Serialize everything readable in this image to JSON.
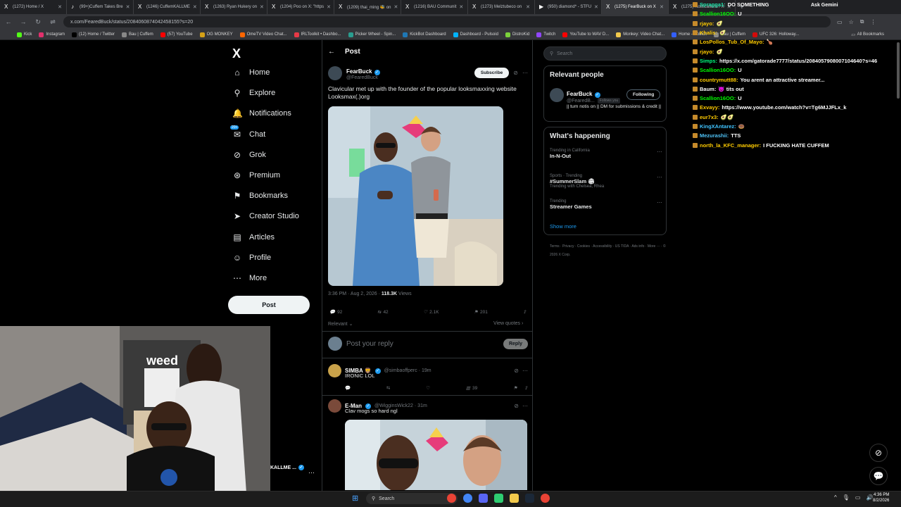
{
  "browser": {
    "tabs": [
      {
        "label": "(1272) Home / X",
        "icon": "X"
      },
      {
        "label": "(99+)Cuffem Takes Bre",
        "icon": "♪"
      },
      {
        "label": "(1246) CuffemKALLME",
        "icon": "X"
      },
      {
        "label": "(1263) Ryan Hukery on",
        "icon": "X"
      },
      {
        "label": "(1204) Poo on X: \"https",
        "icon": "X"
      },
      {
        "label": "(1209) thai_ming 🐝 on",
        "icon": "X"
      },
      {
        "label": "(1216) BAU Communit",
        "icon": "X"
      },
      {
        "label": "(1273) Melztubeco on",
        "icon": "X"
      },
      {
        "label": "(950) diamond* - STFU",
        "icon": "▶"
      },
      {
        "label": "(1275) FearBuck on X",
        "icon": "X",
        "active": true
      },
      {
        "label": "(1275) Notifications / X",
        "icon": "X"
      }
    ],
    "ask_gemini": "Ask Gemini",
    "url": "x.com/FearedBuck/status/2084060874042458155?s=20",
    "bookmarks": [
      "Kick",
      "Instagram",
      "(12) Home / Twitter",
      "Bau | Cuffem",
      "(57) YouTube",
      "OG MONKEY",
      "OmeTV Video Chat...",
      "IRLToolkit • Dashbo...",
      "Picker Wheel - Spin...",
      "KickBot Dashboard",
      "Dashboard - Pulsoid",
      "DistroKid",
      "Twitch",
      "YouTube to WAV D...",
      "Monkey: Video Chat...",
      "Home - Roblox",
      "Bau | Cuffem",
      "UFC 326: Holloway..."
    ],
    "all_bookmarks": "All Bookmarks",
    "bookmark_colors": [
      "#53fc18",
      "#e1306c",
      "#000000",
      "#888888",
      "#ff0000",
      "#d4a017",
      "#ff6600",
      "#e63946",
      "#2a9d8f",
      "#1f77b4",
      "#00b3ff",
      "#7bd13b",
      "#9146ff",
      "#ff0000",
      "#f2c94c",
      "#335fff",
      "#888888",
      "#d20a0a"
    ]
  },
  "sidebar": {
    "logo": "X",
    "items": [
      {
        "label": "Home",
        "icon": "⌂",
        "name": "home"
      },
      {
        "label": "Explore",
        "icon": "⚲",
        "name": "explore"
      },
      {
        "label": "Notifications",
        "icon": "🔔",
        "name": "notifications"
      },
      {
        "label": "Chat",
        "icon": "✉",
        "name": "chat",
        "badge": "20+"
      },
      {
        "label": "Grok",
        "icon": "⊘",
        "name": "grok"
      },
      {
        "label": "Premium",
        "icon": "⊛",
        "name": "premium"
      },
      {
        "label": "Bookmarks",
        "icon": "⚑",
        "name": "bookmarks"
      },
      {
        "label": "Creator Studio",
        "icon": "➤",
        "name": "creator-studio"
      },
      {
        "label": "Articles",
        "icon": "▤",
        "name": "articles"
      },
      {
        "label": "Profile",
        "icon": "☺",
        "name": "profile"
      },
      {
        "label": "More",
        "icon": "⋯",
        "name": "more"
      }
    ],
    "post_button": "Post",
    "account_name": "KALLME ..."
  },
  "post": {
    "header": "Post",
    "author_name": "FearBuck",
    "author_handle": "@FearedBuck",
    "subscribe": "Subscribe",
    "text": "Clavicular met up with the founder of the popular looksmaxxing website Looksmax(.)org",
    "time": "3:36 PM · Aug 2, 2026 ·",
    "views_count": "118.3K",
    "views_label": "Views",
    "replies": "92",
    "reposts": "42",
    "likes": "2.1K",
    "bookmarks": "201",
    "relevant": "Relevant ⌄",
    "view_quotes": "View quotes ›",
    "reply_placeholder": "Post your reply",
    "reply_button": "Reply"
  },
  "replies": [
    {
      "name": "SIMBA 🦁",
      "handle": "@simbaoffperc · 19m",
      "text": "IRONIC LOL",
      "views": "39"
    },
    {
      "name": "E-Man",
      "handle": "@WigginsWick22 · 31m",
      "text": "Clav mogs so hard ngl"
    }
  ],
  "right": {
    "search_placeholder": "Search",
    "relevant_title": "Relevant people",
    "person_name": "FearBuck",
    "person_handle": "@FearedB...",
    "follows_you": "Follows you",
    "following": "Following",
    "person_bio": "|| turn notis on || DM for submissions & credit ||",
    "happening_title": "What's happening",
    "trends": [
      {
        "context": "Trending in California",
        "name": "In-N-Out",
        "extra": ""
      },
      {
        "context": "Sports · Trending",
        "name": "#SummerSlam 🏟",
        "extra": "Trending with Chelsea, Rhea"
      },
      {
        "context": "Trending",
        "name": "Streamer Games",
        "extra": ""
      }
    ],
    "show_more": "Show more",
    "footer": "Terms · Privacy · Cookies · Accessibility · US TIDA · Ads info · More ··· · © 2026 X Corp."
  },
  "chat": [
    {
      "user": "Spragga1:",
      "msg": "DO SOMETHING",
      "color": "#1ee0a8"
    },
    {
      "user": "Scallion16OO:",
      "msg": "U",
      "color": "#00ff00"
    },
    {
      "user": "rjayo:",
      "msg": "🥑",
      "color": "#ffcc00"
    },
    {
      "user": "Khalis:",
      "msg": "🥑",
      "color": "#ffcc00"
    },
    {
      "user": "LosPollos_Tub_Of_Mayo:",
      "msg": "🍗",
      "color": "#ffcc00"
    },
    {
      "user": "rjayo:",
      "msg": "🥑",
      "color": "#ffcc00"
    },
    {
      "user": "Simps:",
      "msg": "https://x.com/gatorade7777/status/2084057908007104640?s=46",
      "color": "#00ff7f"
    },
    {
      "user": "Scallion16OO:",
      "msg": "U",
      "color": "#00ff00"
    },
    {
      "user": "countrymutt88:",
      "msg": "You arent an attractive streamer...",
      "color": "#ffcc00"
    },
    {
      "user": "Baum:",
      "msg": "👿 tits out",
      "color": "#ffffff"
    },
    {
      "user": "Scallion16OO:",
      "msg": "U",
      "color": "#00ff00"
    },
    {
      "user": "Exvayy:",
      "msg": "https://www.youtube.com/watch?v=Tg6MJJFLx_k",
      "color": "#ffcc00"
    },
    {
      "user": "eur7x3:",
      "msg": "🥑🥑",
      "color": "#ffcc00"
    },
    {
      "user": "KingXAntarez:",
      "msg": "🍩",
      "color": "#40c4ff"
    },
    {
      "user": "Mezurashii:",
      "msg": "TTS",
      "color": "#4fc3f7"
    },
    {
      "user": "north_la_KFC_manager:",
      "msg": "I FUCKING HATE CUFFEM",
      "color": "#ffcc00"
    }
  ],
  "taskbar": {
    "search": "Search",
    "time": "4:36 PM",
    "date": "8/2/2026"
  }
}
